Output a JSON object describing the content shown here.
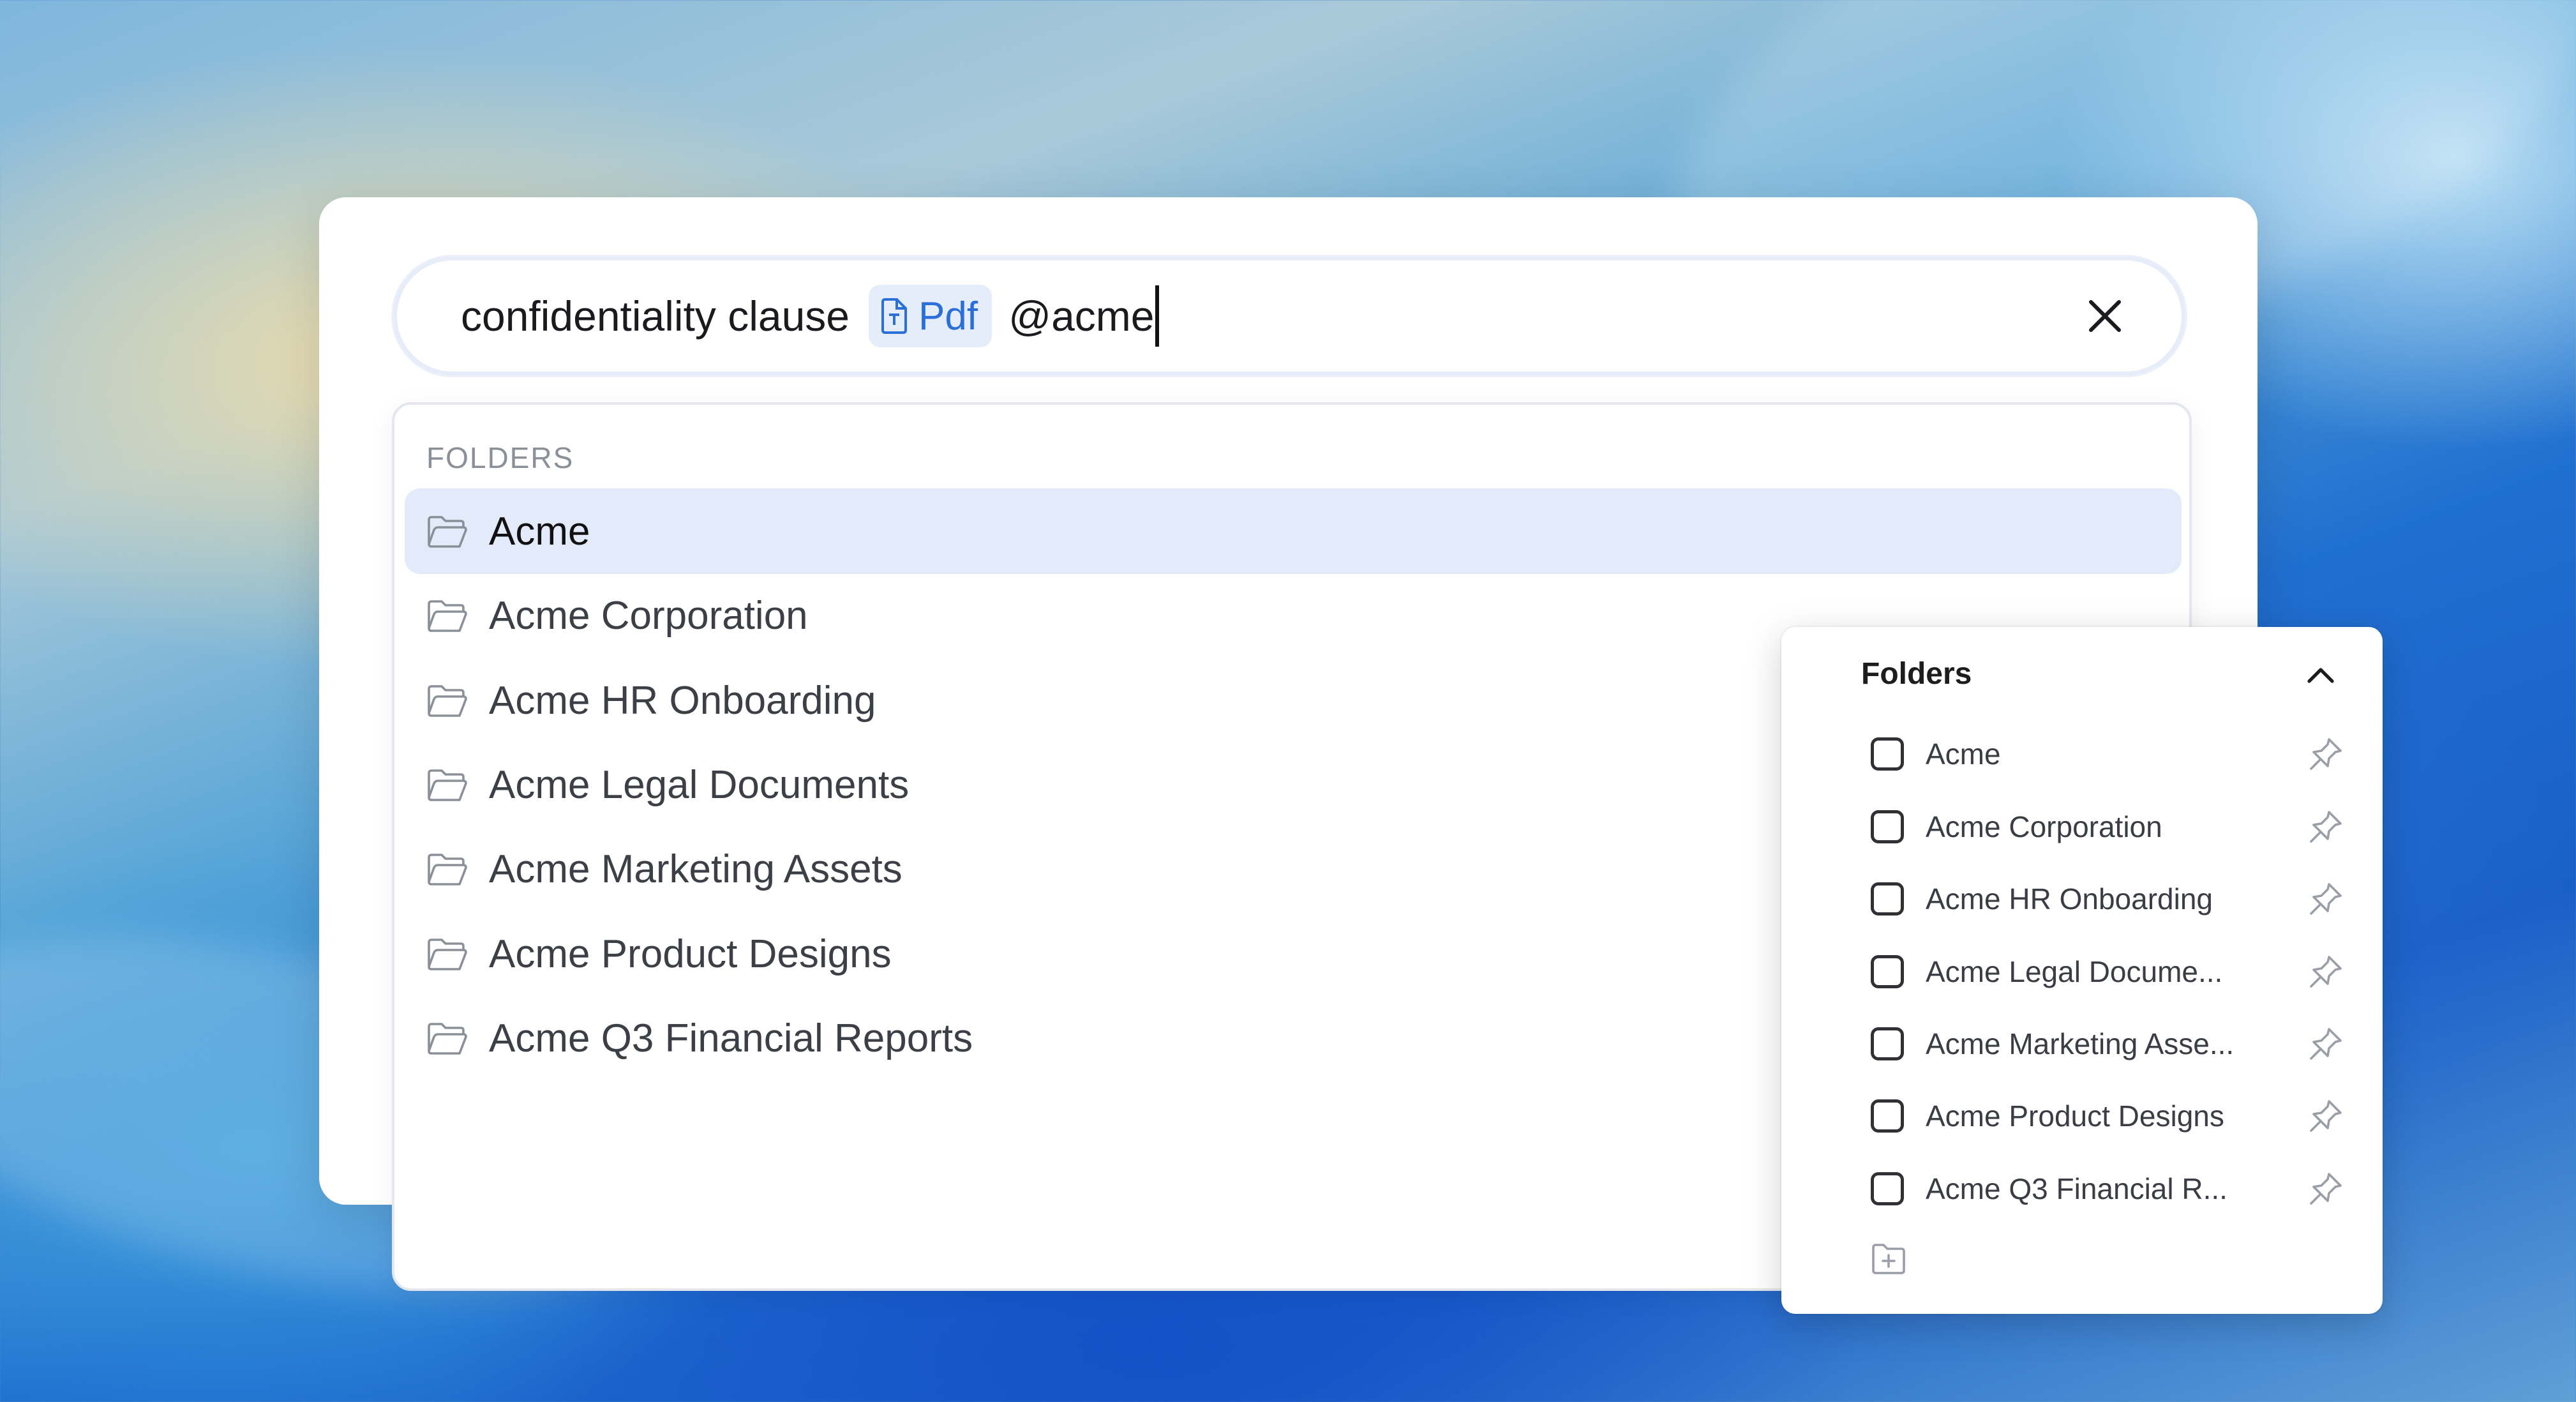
{
  "search": {
    "query": "confidentiality clause",
    "filter_chip": {
      "label": "Pdf",
      "icon": "pdf-file-icon"
    },
    "mention": "@acme",
    "clear_icon": "close-icon"
  },
  "results": {
    "section_label": "FOLDERS",
    "items": [
      {
        "label": "Acme",
        "active": true
      },
      {
        "label": "Acme Corporation"
      },
      {
        "label": "Acme HR Onboarding"
      },
      {
        "label": "Acme Legal Documents"
      },
      {
        "label": "Acme Marketing Assets"
      },
      {
        "label": "Acme Product Designs"
      },
      {
        "label": "Acme Q3 Financial Reports"
      }
    ]
  },
  "filter_panel": {
    "title": "Folders",
    "collapse_icon": "chevron-up-icon",
    "options": [
      {
        "label": "Acme",
        "checked": false
      },
      {
        "label": "Acme Corporation",
        "checked": false
      },
      {
        "label": "Acme HR Onboarding",
        "checked": false
      },
      {
        "label": "Acme Legal Docume...",
        "checked": false
      },
      {
        "label": "Acme Marketing Asse...",
        "checked": false
      },
      {
        "label": "Acme Product Designs",
        "checked": false
      },
      {
        "label": "Acme Q3 Financial R...",
        "checked": false
      }
    ],
    "new_folder_icon": "new-folder-icon"
  },
  "colors": {
    "accent": "#2b6fd9",
    "active_row": "#e3ebfb",
    "chip_bg": "#e5edfb"
  }
}
